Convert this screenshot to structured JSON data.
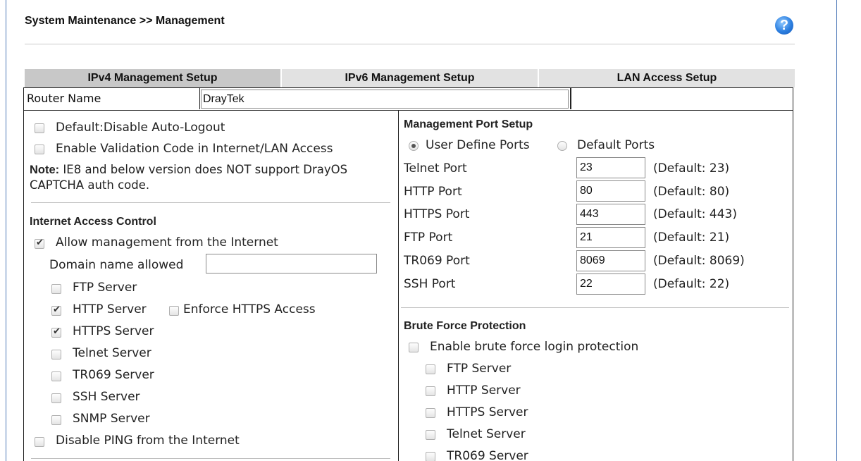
{
  "header": {
    "title": "System Maintenance >> Management",
    "help_icon": "?"
  },
  "tabs": [
    {
      "label": "IPv4 Management Setup",
      "active": true
    },
    {
      "label": "IPv6 Management Setup",
      "active": false
    },
    {
      "label": "LAN Access Setup",
      "active": false
    }
  ],
  "router_name": {
    "label": "Router Name",
    "value": "DrayTek"
  },
  "left": {
    "options": [
      {
        "label": "Default:Disable Auto-Logout",
        "checked": false
      },
      {
        "label": "Enable Validation Code in Internet/LAN Access",
        "checked": false
      }
    ],
    "note_prefix": "Note:",
    "note_text": " IE8 and below version does NOT support DrayOS CAPTCHA auth code.",
    "internet_access": {
      "heading": "Internet Access Control",
      "allow_label": "Allow management from the Internet",
      "allow_checked": true,
      "domain_label": "Domain name allowed",
      "domain_value": "",
      "servers": [
        {
          "label": "FTP Server",
          "checked": false
        },
        {
          "label": "HTTP Server",
          "checked": true
        },
        {
          "label": "HTTPS Server",
          "checked": true
        },
        {
          "label": "Telnet Server",
          "checked": false
        },
        {
          "label": "TR069 Server",
          "checked": false
        },
        {
          "label": "SSH Server",
          "checked": false
        },
        {
          "label": "SNMP Server",
          "checked": false
        }
      ],
      "enforce_https_label": "Enforce HTTPS Access",
      "enforce_https_checked": false,
      "disable_ping_label": "Disable PING from the Internet",
      "disable_ping_checked": false
    }
  },
  "right": {
    "ports": {
      "heading": "Management Port Setup",
      "user_define_label": "User Define Ports",
      "default_label": "Default Ports",
      "selected": "user",
      "rows": [
        {
          "label": "Telnet Port",
          "value": "23",
          "default": "(Default: 23)"
        },
        {
          "label": "HTTP Port",
          "value": "80",
          "default": "(Default: 80)"
        },
        {
          "label": "HTTPS Port",
          "value": "443",
          "default": "(Default: 443)"
        },
        {
          "label": "FTP Port",
          "value": "21",
          "default": "(Default: 21)"
        },
        {
          "label": "TR069 Port",
          "value": "8069",
          "default": "(Default: 8069)"
        },
        {
          "label": "SSH Port",
          "value": "22",
          "default": "(Default: 22)"
        }
      ]
    },
    "brute_force": {
      "heading": "Brute Force Protection",
      "enable_label": "Enable brute force login protection",
      "enable_checked": false,
      "servers": [
        {
          "label": "FTP Server",
          "checked": false
        },
        {
          "label": "HTTP Server",
          "checked": false
        },
        {
          "label": "HTTPS Server",
          "checked": false
        },
        {
          "label": "Telnet Server",
          "checked": false
        },
        {
          "label": "TR069 Server",
          "checked": false
        }
      ]
    }
  }
}
